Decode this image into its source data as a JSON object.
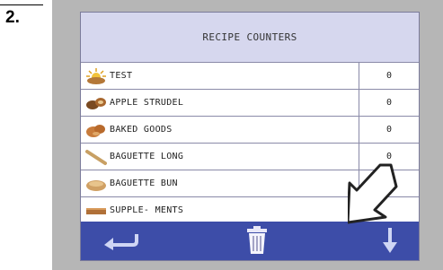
{
  "step": {
    "number": "2."
  },
  "screen": {
    "title": "RECIPE COUNTERS"
  },
  "recipes": [
    {
      "name": "TEST",
      "count": "0",
      "icon": "sun-bread-icon"
    },
    {
      "name": "APPLE STRUDEL",
      "count": "0",
      "icon": "strudel-icon"
    },
    {
      "name": "BAKED GOODS",
      "count": "0",
      "icon": "pastry-icon"
    },
    {
      "name": "BAGUETTE LONG",
      "count": "0",
      "icon": "baguette-icon"
    },
    {
      "name": "BAGUETTE BUN",
      "count": "0",
      "icon": "bun-icon"
    },
    {
      "name": "SUPPLE- MENTS",
      "count": "",
      "icon": "supplements-icon"
    }
  ],
  "footer": {
    "buttons": [
      "back-arrow-icon",
      "trash-icon",
      "scroll-down-icon"
    ]
  },
  "colors": {
    "header": "#d6d7ee",
    "footer": "#3d4da8",
    "frame": "#b6b6b6"
  }
}
